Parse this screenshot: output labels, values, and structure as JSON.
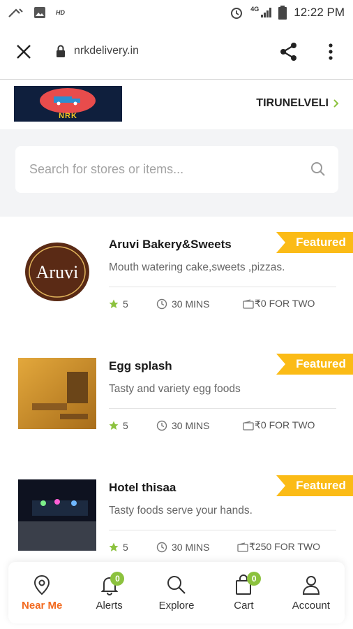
{
  "status_bar": {
    "hd_label": "HD",
    "network": "4G",
    "time": "12:22 PM"
  },
  "browser": {
    "url": "nrkdelivery.in"
  },
  "header": {
    "logo_text": "NRK",
    "city": "TIRUNELVELI"
  },
  "search": {
    "placeholder": "Search for stores or items..."
  },
  "stores": [
    {
      "name": "Aruvi Bakery&Sweets",
      "description": "Mouth watering cake,sweets ,pizzas.",
      "rating": "5",
      "time": "30 MINS",
      "price": "₹0 FOR TWO",
      "badge": "Featured",
      "logo_text": "Aruvi"
    },
    {
      "name": "Egg splash",
      "description": "Tasty and variety egg foods",
      "rating": "5",
      "time": "30 MINS",
      "price": "₹0 FOR TWO",
      "badge": "Featured"
    },
    {
      "name": "Hotel thisaa",
      "description": "Tasty foods serve your hands.",
      "rating": "5",
      "time": "30 MINS",
      "price": "₹250 FOR TWO",
      "badge": "Featured"
    }
  ],
  "nav": {
    "items": [
      {
        "label": "Near Me",
        "icon": "location-pin-icon"
      },
      {
        "label": "Alerts",
        "icon": "bell-icon",
        "badge": "0"
      },
      {
        "label": "Explore",
        "icon": "search-icon"
      },
      {
        "label": "Cart",
        "icon": "cart-icon",
        "badge": "0"
      },
      {
        "label": "Account",
        "icon": "user-icon"
      }
    ]
  },
  "colors": {
    "accent": "#f2691e",
    "featured": "#fbbb16",
    "badge": "#8cc23e",
    "star": "#8cc23e"
  }
}
